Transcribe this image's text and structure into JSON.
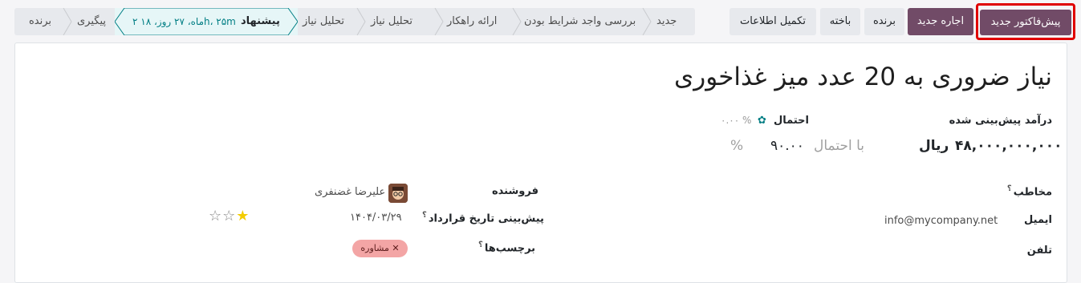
{
  "actions": {
    "new_quotation": "پیش‌فاکتور جدید",
    "new_rental": "اجاره جدید",
    "won": "برنده",
    "lost": "باخته",
    "enrich": "تکمیل اطلاعات"
  },
  "stages": {
    "new": "جدید",
    "qualification_check": "بررسی واجد شرایط بودن",
    "solution": "ارائه راهکار",
    "needs_analysis_1": "تحلیل نیاز",
    "needs_analysis_2": "تحلیل نیاز",
    "proposal": "پیشنهاد",
    "proposal_duration": "۲ ماه، ۲۷ روز، ۱۸h، ۲۵m",
    "followup": "پیگیری",
    "won": "برنده"
  },
  "opportunity": {
    "title": "نیاز ضروری به 20 عدد میز غذاخوری",
    "expected_revenue_label": "درآمد پیش‌بینی شده",
    "expected_revenue": "۴۸,۰۰۰,۰۰۰,۰۰۰",
    "currency": "ریال",
    "probability_label": "احتمال",
    "probability_auto": "۰.۰۰ %",
    "with_probability": "با احتمال",
    "probability": "۹۰.۰۰",
    "percent": "%"
  },
  "fields": {
    "contact_label": "مخاطب",
    "email_label": "ایمیل",
    "email": "info@mycompany.net",
    "phone_label": "تلفن",
    "salesperson_label": "فروشنده",
    "salesperson": "علیرضا غضنفری",
    "expected_closing_label": "پیش‌بینی تاریخ قرارداد",
    "expected_closing": "۱۴۰۴/۰۳/۲۹",
    "tags_label": "برچسب‌ها",
    "tag": "مشاوره",
    "help_mark": "؟",
    "priority": 1
  },
  "colors": {
    "primary": "#714b67",
    "highlight": "#e00000",
    "current_stage_bg": "#e6f6f7",
    "teal": "#017e84",
    "tag_bg": "#f3a5a5"
  }
}
